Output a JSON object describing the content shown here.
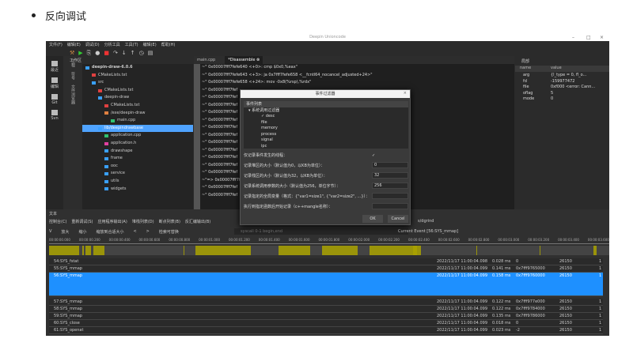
{
  "heading": "反向调试",
  "app": {
    "title": "Deepin Unioncode",
    "window_controls": [
      "–",
      "□",
      "×"
    ],
    "menu": [
      "文件(F)",
      "编辑(E)",
      "调试(D)",
      "分析工具",
      "工具(T)",
      "编辑(E)",
      "帮助(H)"
    ],
    "activity": [
      "最近",
      "编辑",
      "Git",
      "Svn"
    ],
    "vtabs": [
      "工程",
      "符号",
      "文件浏览器"
    ],
    "workspace_label": "工作区",
    "tree": [
      {
        "label": "deepin-draw-6.0.6",
        "indent": 0,
        "color": "#3aa0ff",
        "bold": true
      },
      {
        "label": "CMakeLists.txt",
        "indent": 1,
        "color": "#e04040"
      },
      {
        "label": "src",
        "indent": 1,
        "color": "#3aa0ff"
      },
      {
        "label": "CMakeLists.txt",
        "indent": 2,
        "color": "#e04040"
      },
      {
        "label": "deepin-draw",
        "indent": 2,
        "color": "#3aa0ff"
      },
      {
        "label": "CMakeLists.txt",
        "indent": 3,
        "color": "#e04040"
      },
      {
        "label": "/exe/deepin-draw",
        "indent": 3,
        "color": "#e08040"
      },
      {
        "label": "main.cpp",
        "indent": 4,
        "color": "#30c070"
      },
      {
        "label": "lib/deepindrawbase",
        "indent": 2,
        "color": "#3aa0ff",
        "selected": true
      },
      {
        "label": "application.cpp",
        "indent": 3,
        "color": "#30c070"
      },
      {
        "label": "application.h",
        "indent": 3,
        "color": "#e040a0"
      },
      {
        "label": "drawshape",
        "indent": 3,
        "color": "#3aa0ff"
      },
      {
        "label": "frame",
        "indent": 3,
        "color": "#3aa0ff"
      },
      {
        "label": "ooc",
        "indent": 3,
        "color": "#3aa0ff"
      },
      {
        "label": "service",
        "indent": 3,
        "color": "#3aa0ff"
      },
      {
        "label": "utils",
        "indent": 3,
        "color": "#3aa0ff"
      },
      {
        "label": "widgets",
        "indent": 3,
        "color": "#3aa0ff"
      }
    ],
    "editor_tabs": [
      "main.cpp",
      "*Disassemble"
    ],
    "code": [
      "~\"  0x00007fff7fefe640 <+0>:  cmp   $0x0,%eax\"",
      "~\"  0x00007fff7fefe643 <+3>:  ja    0x7fff7fefe658 <__fcntl64_nocancel_adjusted+24>\"",
      "~\"  0x00007fff7fefe658 <+24>: mov   -0x8(%rsp),%rdx\"",
      "~\"  0x00007fff7fef",
      "~\"  0x00007fff7fef",
      "~\"  0x00007fff7fef",
      "~\"  0x00007fff7fef",
      "~\"  0x00007fff7fef",
      "~\"  0x00007fff7fef",
      "~\"  0x00007fff7fef",
      "~\"  0x00007fff7fef",
      "~\"  0x00007fff7fef",
      "~\"  0x00007fff7fef",
      "~\"  0x00007fff7fef",
      "~\"  0x00007fff7fef",
      "~\"=> 0x00007fff7fe",
      "~\"  0x00007fff7fef",
      "~\"  0x00007fff7fef"
    ],
    "vars": {
      "tab": "局部",
      "headers": [
        "name",
        "value"
      ],
      "rows": [
        [
          "arg",
          "{l_type = 0, fl_o..."
        ],
        [
          "fd",
          "-159977472"
        ],
        [
          "file",
          "0xf000 <error: Cann..."
        ],
        [
          "oflag",
          "5"
        ],
        [
          "mode",
          "0"
        ]
      ]
    },
    "dialog": {
      "title": "事件过滤器",
      "list_header": "事件列表",
      "group": "系统调用过滤器",
      "events": [
        "desc",
        "file",
        "memory",
        "process",
        "signal",
        "ipc"
      ],
      "fields": [
        {
          "label": "仅记录事件发生的线程：",
          "value": "✓"
        },
        {
          "label": "记录堆区的大小（默认值为0，以KB为单位）：",
          "value": "0"
        },
        {
          "label": "记录栈区的大小（默认值为32，以KB为单位）：",
          "value": "32"
        },
        {
          "label": "记录系统调用参数的大小（默认值为256，单位字节）：",
          "value": "256"
        },
        {
          "label": "记录指定的全局变量（格式：{\"var1=size1\", {\"var2=size2\", ...}）：",
          "value": ""
        },
        {
          "label": "执行到指定函数后开始记录（c++mangle名称）：",
          "value": ""
        }
      ],
      "ok": "OK",
      "cancel": "Cancel"
    },
    "bottom": {
      "label": "文本",
      "tabs": [
        "控制台(C)",
        "重新调试(S)",
        "应用程序输出(A)",
        "堆栈列表(D)",
        "断点列表(B)",
        "反汇编输出(B)"
      ],
      "tail": "s/dgrind",
      "tools": [
        "V",
        "放大",
        "缩小",
        "缩放到合适大小",
        "<",
        ">",
        "检索可替换"
      ],
      "search_placeholder": "syscall 0-1 begin,end",
      "current_event": "Current Event [56:SYS_mmap]",
      "ticks": [
        "00:00:00.000",
        "00:00:00.200",
        "00:00:00.400",
        "00:00:00.600",
        "00:00:00.800",
        "00:00:01.000",
        "00:00:01.200",
        "00:00:01.400",
        "00:00:01.600",
        "00:00:01.800",
        "00:00:02.000",
        "00:00:02.200",
        "00:00:02.400",
        "00:00:02.600",
        "00:00:02.800",
        "00:00:03.000",
        "00:00:03.200",
        "00:00:03.400",
        "00:00:03.600"
      ],
      "rows": [
        {
          "name": "54:SYS_fstat",
          "time": "2022/11/17 11:00:04.098",
          "dur": "0.028 ms",
          "ret": "0",
          "pid": "26150",
          "n": "1"
        },
        {
          "name": "55:SYS_mmap",
          "time": "2022/11/17 11:00:04.099",
          "dur": "0.141 ms",
          "ret": "0x7fff9765000",
          "pid": "26150",
          "n": "1"
        },
        {
          "name": "56:SYS_mmap",
          "time": "2022/11/17 11:00:04.099",
          "dur": "0.158 ms",
          "ret": "0x7fff9760000",
          "pid": "26150",
          "n": "1",
          "selected": true
        },
        {
          "name": "57:SYS_mmap",
          "time": "2022/11/17 11:00:04.099",
          "dur": "0.122 ms",
          "ret": "0x7fff977e000",
          "pid": "26150",
          "n": "1"
        },
        {
          "name": "58:SYS_mmap",
          "time": "2022/11/17 11:00:04.099",
          "dur": "0.122 ms",
          "ret": "0x7fff9784000",
          "pid": "26150",
          "n": "1"
        },
        {
          "name": "59:SYS_mmap",
          "time": "2022/11/17 11:00:04.099",
          "dur": "0.135 ms",
          "ret": "0x7fff9786000",
          "pid": "26150",
          "n": "1"
        },
        {
          "name": "60:SYS_close",
          "time": "2022/11/17 11:00:04.099",
          "dur": "0.018 ms",
          "ret": "0",
          "pid": "26150",
          "n": "1"
        },
        {
          "name": "61:SYS_openat",
          "time": "2022/11/17 11:00:04.099",
          "dur": "0.023 ms",
          "ret": "-2",
          "pid": "26150",
          "n": "1"
        }
      ]
    },
    "colors": {
      "selection": "#1e90ff",
      "trace": "#a9a200",
      "tree_selection": "#4fa3ff"
    }
  }
}
